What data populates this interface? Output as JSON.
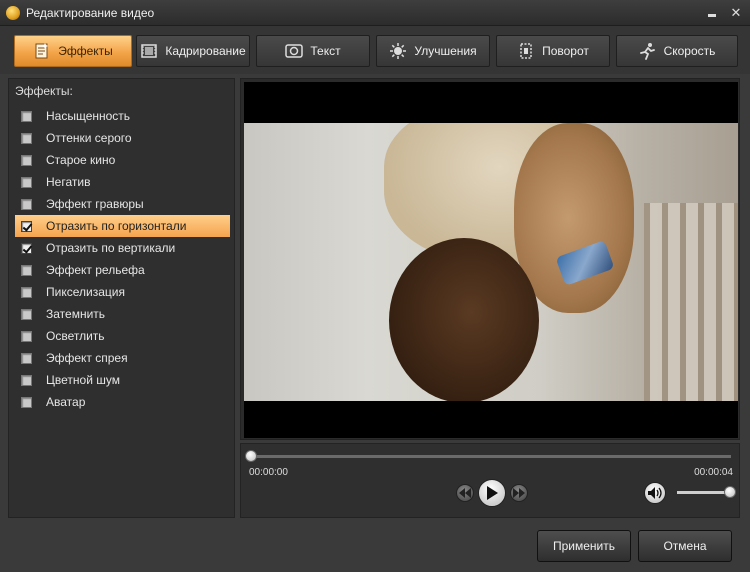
{
  "window": {
    "title": "Редактирование видео",
    "icons": {
      "app": "app-icon",
      "minimize": "minimize-icon",
      "close": "close-icon"
    }
  },
  "tabs": [
    {
      "label": "Эффекты",
      "icon": "effects-icon",
      "active": true
    },
    {
      "label": "Кадрирование",
      "icon": "crop-icon",
      "active": false
    },
    {
      "label": "Текст",
      "icon": "text-icon",
      "active": false
    },
    {
      "label": "Улучшения",
      "icon": "enhance-icon",
      "active": false
    },
    {
      "label": "Поворот",
      "icon": "rotate-icon",
      "active": false
    },
    {
      "label": "Скорость",
      "icon": "speed-icon",
      "active": false
    }
  ],
  "effects_panel": {
    "title": "Эффекты:",
    "items": [
      {
        "label": "Насыщенность",
        "checked": false,
        "selected": false
      },
      {
        "label": "Оттенки серого",
        "checked": false,
        "selected": false
      },
      {
        "label": "Старое кино",
        "checked": false,
        "selected": false
      },
      {
        "label": "Негатив",
        "checked": false,
        "selected": false
      },
      {
        "label": "Эффект гравюры",
        "checked": false,
        "selected": false
      },
      {
        "label": "Отразить по горизонтали",
        "checked": true,
        "selected": true
      },
      {
        "label": "Отразить по вертикали",
        "checked": true,
        "selected": false
      },
      {
        "label": "Эффект рельефа",
        "checked": false,
        "selected": false
      },
      {
        "label": "Пикселизация",
        "checked": false,
        "selected": false
      },
      {
        "label": "Затемнить",
        "checked": false,
        "selected": false
      },
      {
        "label": "Осветлить",
        "checked": false,
        "selected": false
      },
      {
        "label": "Эффект спрея",
        "checked": false,
        "selected": false
      },
      {
        "label": "Цветной шум",
        "checked": false,
        "selected": false
      },
      {
        "label": "Аватар",
        "checked": false,
        "selected": false
      }
    ]
  },
  "player": {
    "current_time": "00:00:00",
    "total_time": "00:00:04",
    "progress": 0,
    "volume": 1.0,
    "icons": {
      "prev": "rewind-icon",
      "play": "play-icon",
      "next": "forward-icon",
      "volume": "speaker-icon"
    }
  },
  "buttons": {
    "apply": "Применить",
    "cancel": "Отмена"
  },
  "colors": {
    "accent": "#f3a54a",
    "background": "#3a3a3a",
    "panel": "#2f2f2f"
  }
}
